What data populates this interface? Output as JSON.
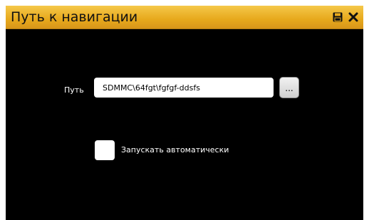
{
  "window": {
    "title": "Путь к навигации",
    "save_icon": "save-icon",
    "close_icon": "close-icon"
  },
  "form": {
    "path_label": "Путь",
    "path_value": "SDMMC\\64fgt\\fgfgf-ddsfs",
    "browse_label": "...",
    "autostart_label": "Запускать автоматически",
    "autostart_checked": false
  },
  "colors": {
    "title_bar": "#e7a91c",
    "background": "#000000"
  }
}
